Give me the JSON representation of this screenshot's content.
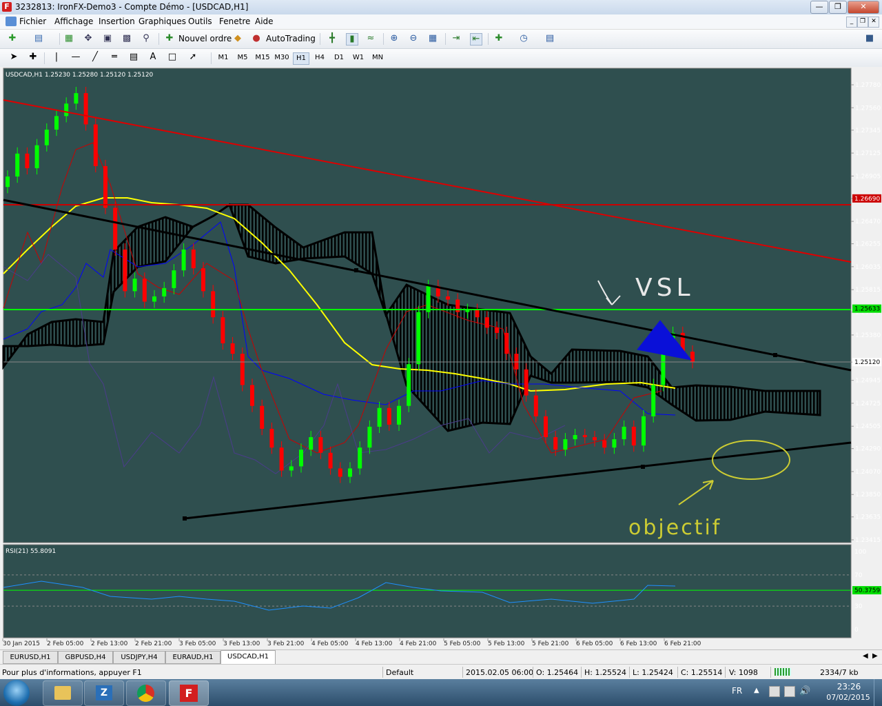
{
  "window": {
    "title": "3232813: IronFX-Demo3 - Compte Démo - [USDCAD,H1]",
    "app_icon": "F",
    "controls": [
      "minimize-icon",
      "restore-icon",
      "close-icon"
    ]
  },
  "menu": {
    "items": [
      "Fichier",
      "Affichage",
      "Insertion",
      "Graphiques",
      "Outils",
      "Fenetre",
      "Aide"
    ]
  },
  "toolbar": {
    "new_order": "Nouvel ordre",
    "autotrading": "AutoTrading",
    "search_placeholder": ""
  },
  "timeframes": [
    "M1",
    "M5",
    "M15",
    "M30",
    "H1",
    "H4",
    "D1",
    "W1",
    "MN"
  ],
  "active_timeframe": "H1",
  "chart": {
    "header": "USDCAD,H1  1.25230 1.25280 1.25120 1.25120",
    "background": "#2f4f4f",
    "price_labels": [
      "1.27780",
      "1.27560",
      "1.27345",
      "1.27125",
      "1.26905",
      "1.26690",
      "1.26470",
      "1.26255",
      "1.26035",
      "1.25815",
      "1.25600",
      "1.25380",
      "1.25120",
      "1.24945",
      "1.24725",
      "1.24505",
      "1.24290",
      "1.24070",
      "1.23850",
      "1.23635",
      "1.23415"
    ],
    "red_line_tag": "1.26690",
    "green_line_tag": "1.25633",
    "current_price_tag": "1.25120",
    "time_labels": [
      "30 Jan 2015",
      "2 Feb 05:00",
      "2 Feb 13:00",
      "2 Feb 21:00",
      "3 Feb 05:00",
      "3 Feb 13:00",
      "3 Feb 21:00",
      "4 Feb 05:00",
      "4 Feb 13:00",
      "4 Feb 21:00",
      "5 Feb 05:00",
      "5 Feb 13:00",
      "5 Feb 21:00",
      "6 Feb 05:00",
      "6 Feb 13:00",
      "6 Feb 21:00"
    ],
    "annotation_vsl": "VSL",
    "annotation_objectif": "objectif",
    "rsi_header": "RSI(21) 55.8091",
    "rsi_labels": [
      "100",
      "70",
      "50.3759",
      "30",
      "0"
    ],
    "colors": {
      "bull": "#00ff00",
      "bear": "#ff0000",
      "ma": "#ffff00",
      "tenkan": "#0000ff",
      "kijun": "#cc0000",
      "chikou": "#4b3c8c",
      "rsi": "#1e90ff"
    }
  },
  "tabs": [
    "EURUSD,H1",
    "GBPUSD,H4",
    "USDJPY,H4",
    "EURAUD,H1",
    "USDCAD,H1"
  ],
  "active_tab": "USDCAD,H1",
  "status": {
    "help": "Pour plus d'informations, appuyer F1",
    "profile": "Default",
    "datetime": "2015.02.05 06:00",
    "open": "O: 1.25464",
    "high": "H: 1.25524",
    "low": "L: 1.25424",
    "close": "C: 1.25514",
    "volume": "V: 1098",
    "traffic": "2334/7 kb"
  },
  "taskbar": {
    "lang": "FR",
    "time": "23:26",
    "date": "07/02/2015"
  }
}
